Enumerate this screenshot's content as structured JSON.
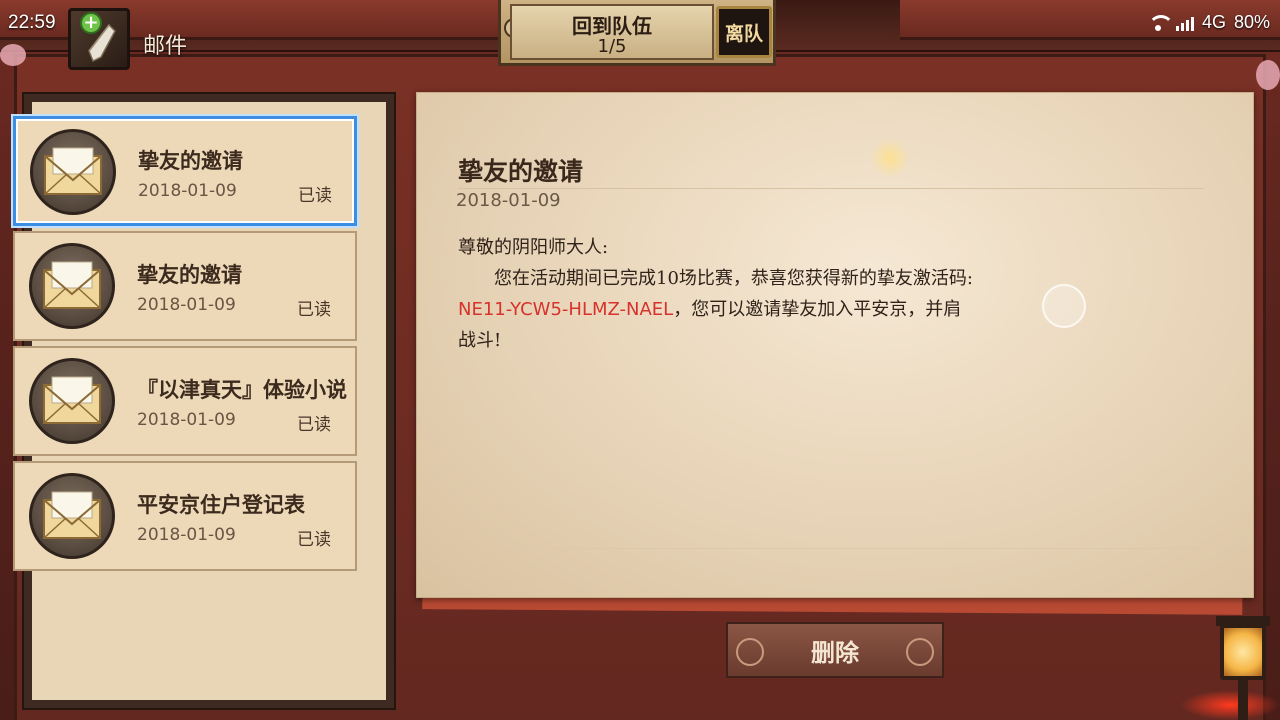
{
  "status_bar": {
    "time": "22:59",
    "network": "4G",
    "battery": "80%"
  },
  "header": {
    "title": "邮件"
  },
  "team": {
    "label": "回到队伍",
    "count": "1/5",
    "leave_label": "离队"
  },
  "mail_list": [
    {
      "subject": "挚友的邀请",
      "date": "2018-01-09",
      "status": "已读"
    },
    {
      "subject": "挚友的邀请",
      "date": "2018-01-09",
      "status": "已读"
    },
    {
      "subject": "『以津真天』体验小说",
      "date": "2018-01-09",
      "status": "已读"
    },
    {
      "subject": "平安京住户登记表",
      "date": "2018-01-09",
      "status": "已读"
    }
  ],
  "letter": {
    "title": "挚友的邀请",
    "date": "2018-01-09",
    "greeting": "尊敬的阴阳师大人:",
    "line1": "　　您在活动期间已完成10场比赛，恭喜您获得新的挚友激活码:",
    "code": "NE11-YCW5-HLMZ-NAEL",
    "line2_rest": "，您可以邀请挚友加入平安京，并肩",
    "line3": "战斗!"
  },
  "actions": {
    "delete_label": "删除"
  },
  "colors": {
    "accent_selected": "#3d8ee0",
    "code_red": "#d8322c",
    "panel_bg": "#e9d6b6"
  }
}
